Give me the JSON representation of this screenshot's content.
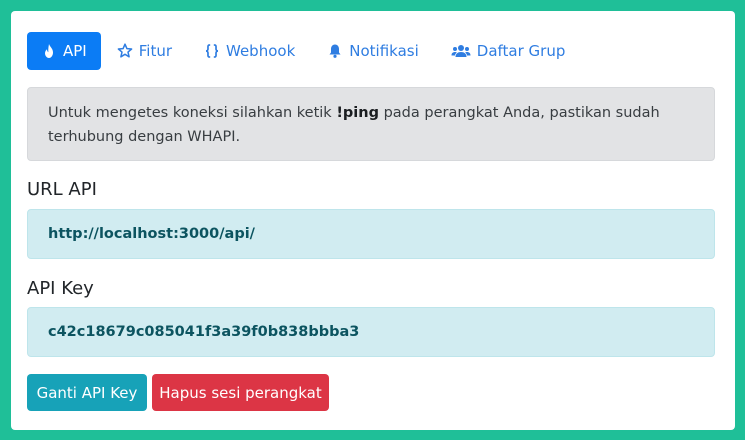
{
  "tabs": [
    {
      "label": "API",
      "icon": "fire-icon"
    },
    {
      "label": "Fitur",
      "icon": "star-icon"
    },
    {
      "label": "Webhook",
      "icon": "code-braces-icon"
    },
    {
      "label": "Notifikasi",
      "icon": "bell-icon"
    },
    {
      "label": "Daftar Grup",
      "icon": "users-icon"
    }
  ],
  "alert": {
    "text_before": "Untuk mengetes koneksi silahkan ketik ",
    "command": "!ping",
    "text_after": " pada perangkat Anda, pastikan sudah terhubung dengan WHAPI."
  },
  "api_url": {
    "label": "URL API",
    "value": "http://localhost:3000/api/"
  },
  "api_key": {
    "label": "API Key",
    "value": "c42c18679c085041f3a39f0b838bbba3"
  },
  "buttons": {
    "change_key": "Ganti API Key",
    "delete_session": "Hapus sesi perangkat"
  },
  "colors": {
    "page_background": "#1fbf98",
    "primary": "#0b7cf5",
    "link": "#2f7de1",
    "info_button": "#17a2b8",
    "danger_button": "#dc3545",
    "info_box": "#d1ecf1",
    "alert_box": "#e2e3e5"
  }
}
